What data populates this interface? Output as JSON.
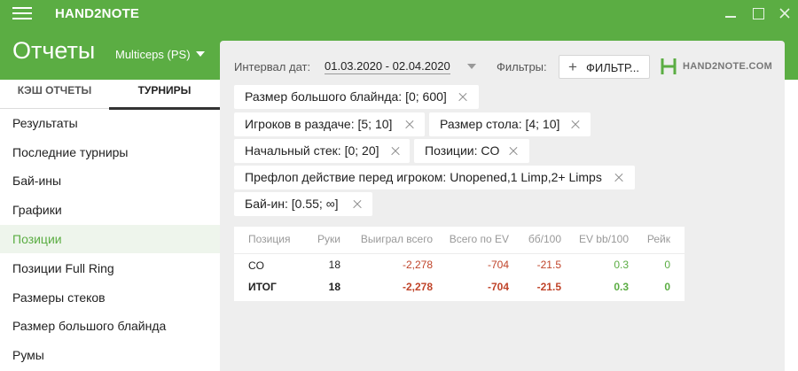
{
  "app": {
    "title": "HAND2NOTE"
  },
  "header": {
    "page_title": "Отчеты",
    "account": "Multiceps (PS)"
  },
  "sidebar": {
    "tabs": [
      {
        "label": "КЭШ ОТЧЕТЫ"
      },
      {
        "label": "ТУРНИРЫ",
        "active": true
      }
    ],
    "items": [
      {
        "label": "Результаты"
      },
      {
        "label": "Последние турниры"
      },
      {
        "label": "Бай-ины"
      },
      {
        "label": "Графики"
      },
      {
        "label": "Позиции",
        "active": true
      },
      {
        "label": "Позиции Full Ring"
      },
      {
        "label": "Размеры стеков"
      },
      {
        "label": "Размер большого блайнда"
      },
      {
        "label": "Румы"
      }
    ]
  },
  "toolbar": {
    "date_label": "Интервал дат:",
    "date_value": "01.03.2020 - 02.04.2020",
    "filters_label": "Фильтры:",
    "filter_button": "ФИЛЬТР...",
    "logo_text": "HAND2NOTE.COM"
  },
  "filter_chips": [
    {
      "label": "Размер большого блайнда: [0; 600]"
    },
    {
      "label": "Игроков в раздаче: [5; 10]"
    },
    {
      "label": "Размер стола: [4; 10]"
    },
    {
      "label": "Начальный стек: [0; 20]"
    },
    {
      "label": "Позиции: CO"
    },
    {
      "label": "Префлоп действие перед игроком: Unopened,1 Limp,2+ Limps"
    },
    {
      "label": "Бай-ин: [0.55; ∞]"
    }
  ],
  "table": {
    "columns": [
      "Позиция",
      "Руки",
      "Выиграл всего",
      "Всего по EV",
      "бб/100",
      "EV bb/100",
      "Рейк"
    ],
    "rows": [
      [
        "CO",
        "18",
        "-2,278",
        "-704",
        "-21.5",
        "0.3",
        "0"
      ]
    ],
    "total": [
      "ИТОГ",
      "18",
      "-2,278",
      "-704",
      "-21.5",
      "0.3",
      "0"
    ]
  },
  "colors": {
    "brand_green": "#5bad43",
    "negative": "#c0442a",
    "positive": "#5bad43"
  },
  "icons": [
    "menu-icon",
    "minimize-icon",
    "maximize-icon",
    "close-icon",
    "caret-down-icon",
    "plus-icon",
    "hand2note-logo-icon",
    "chip-close-icon"
  ]
}
